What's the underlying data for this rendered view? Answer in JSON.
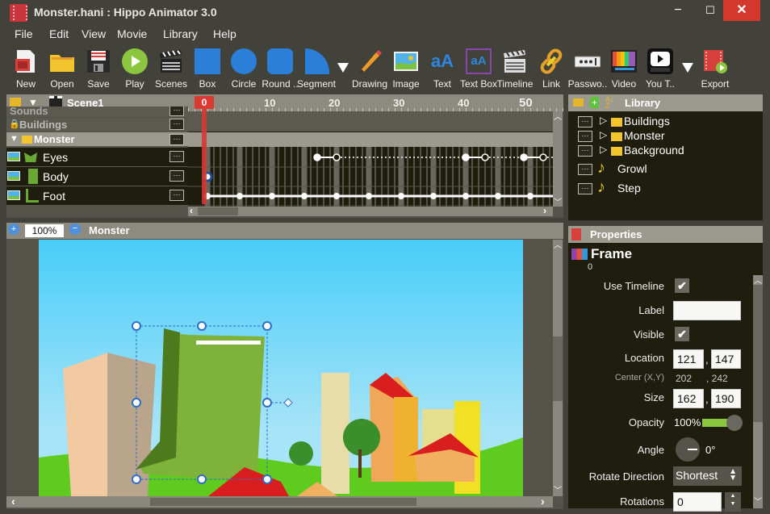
{
  "window": {
    "title": "Monster.hani : Hippo Animator 3.0",
    "minimize": "−",
    "maximize": "☐",
    "close": "✕"
  },
  "menu": [
    "File",
    "Edit",
    "View",
    "Movie",
    "Library",
    "Help"
  ],
  "toolbar": [
    {
      "label": "New",
      "icon": "new-file-icon"
    },
    {
      "label": "Open",
      "icon": "folder-icon"
    },
    {
      "label": "Save",
      "icon": "floppy-disk-icon"
    },
    {
      "label": "Play",
      "icon": "play-icon"
    },
    {
      "label": "Scenes",
      "icon": "clapperboard-icon"
    },
    {
      "label": "Box",
      "icon": "square-icon"
    },
    {
      "label": "Circle",
      "icon": "circle-icon"
    },
    {
      "label": "Round ..",
      "icon": "rounded-rect-icon"
    },
    {
      "label": "Segment",
      "icon": "segment-icon"
    },
    {
      "label": "Drawing",
      "icon": "pencil-icon"
    },
    {
      "label": "Image",
      "icon": "image-icon"
    },
    {
      "label": "Text",
      "icon": "text-icon"
    },
    {
      "label": "Text Box",
      "icon": "text-box-icon"
    },
    {
      "label": "Timeline",
      "icon": "timeline-clapper-icon"
    },
    {
      "label": "Link",
      "icon": "chain-link-icon"
    },
    {
      "label": "Passwo..",
      "icon": "password-icon"
    },
    {
      "label": "Video",
      "icon": "video-icon"
    },
    {
      "label": "You T..",
      "icon": "youtube-icon"
    },
    {
      "label": "Export",
      "icon": "export-icon"
    }
  ],
  "timeline": {
    "scene": "Scene1",
    "current_frame": "0",
    "ruler_labels": [
      "10",
      "20",
      "30",
      "40",
      "50"
    ],
    "layers": [
      {
        "name": "Sounds",
        "type": "locked-layer"
      },
      {
        "name": "Buildings",
        "type": "locked-layer"
      },
      {
        "name": "Monster",
        "type": "folder"
      },
      {
        "name": "Eyes",
        "type": "object"
      },
      {
        "name": "Body",
        "type": "object"
      },
      {
        "name": "Foot",
        "type": "object"
      }
    ],
    "keyframes": {
      "Eyes": [
        17,
        20,
        40,
        43,
        49,
        52
      ],
      "Body": [
        0
      ],
      "Foot": [
        0,
        5,
        10,
        15,
        20,
        25,
        30,
        35,
        40,
        45,
        50
      ]
    }
  },
  "library": {
    "title": "Library",
    "items": [
      {
        "name": "Buildings",
        "type": "folder"
      },
      {
        "name": "Monster",
        "type": "folder"
      },
      {
        "name": "Background",
        "type": "folder"
      },
      {
        "name": "Growl",
        "type": "sound"
      },
      {
        "name": "Step",
        "type": "sound"
      }
    ]
  },
  "stage": {
    "zoom": "100%",
    "title": "Monster"
  },
  "properties": {
    "title": "Properties",
    "object_type": "Frame",
    "frame_number": "0",
    "use_timeline_label": "Use Timeline",
    "use_timeline": true,
    "label_label": "Label",
    "label_value": "",
    "visible_label": "Visible",
    "visible": true,
    "location_label": "Location",
    "location_x": "121",
    "location_y": "147",
    "center_label": "Center (X,Y)",
    "center_x": "202",
    "center_y": ", 242",
    "size_label": "Size",
    "size_w": "162",
    "size_h": "190",
    "opacity_label": "Opacity",
    "opacity_value": "100%",
    "opacity_fraction": 1.0,
    "angle_label": "Angle",
    "angle_value": "0°",
    "rotate_direction_label": "Rotate Direction",
    "rotate_direction": "Shortest",
    "rotations_label": "Rotations",
    "rotations": "0",
    "sep": ","
  },
  "colors": {
    "accent_red": "#d93b33",
    "slider_green": "#8cc63f",
    "panel_bg": "#1f1d0e",
    "chrome_bg": "#43423a"
  }
}
